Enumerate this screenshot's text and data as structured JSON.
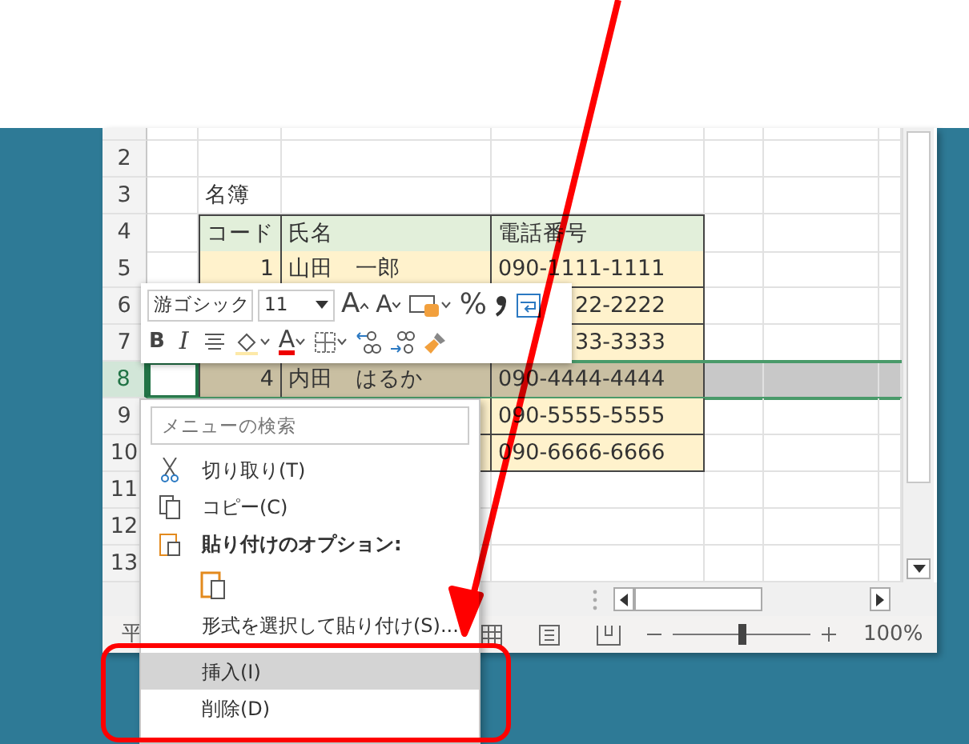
{
  "sheet": {
    "rows": [
      {
        "number": "2",
        "selected": false,
        "cells": [
          {
            "kind": "blank"
          },
          {
            "kind": "blank"
          },
          {
            "kind": "blank"
          },
          {
            "kind": "blank"
          }
        ]
      },
      {
        "number": "3",
        "selected": false,
        "cells": [
          {
            "kind": "blank"
          },
          {
            "text": "名簿",
            "kind": "plain"
          },
          {
            "kind": "blank"
          },
          {
            "kind": "blank"
          }
        ]
      },
      {
        "number": "4",
        "selected": false,
        "cells": [
          {
            "kind": "blank"
          },
          {
            "text": "コード",
            "kind": "head"
          },
          {
            "text": "氏名",
            "kind": "head"
          },
          {
            "text": "電話番号",
            "kind": "head"
          }
        ]
      },
      {
        "number": "5",
        "selected": false,
        "cells": [
          {
            "kind": "blank"
          },
          {
            "text": "1",
            "kind": "number"
          },
          {
            "text": "山田　一郎",
            "kind": "text"
          },
          {
            "text": "090-1111-1111",
            "kind": "text"
          }
        ]
      },
      {
        "number": "6",
        "selected": false,
        "cells": [
          {
            "kind": "blank"
          },
          {
            "kind": "number"
          },
          {
            "kind": "text"
          },
          {
            "text": "22-2222",
            "kind": "tail"
          }
        ]
      },
      {
        "number": "7",
        "selected": false,
        "cells": [
          {
            "kind": "blank"
          },
          {
            "kind": "number"
          },
          {
            "kind": "text"
          },
          {
            "text": "33-3333",
            "kind": "tail"
          }
        ]
      },
      {
        "number": "8",
        "selected": true,
        "cells": [
          {
            "kind": "active"
          },
          {
            "text": "4",
            "kind": "number"
          },
          {
            "text": "内田　はるか",
            "kind": "text"
          },
          {
            "text": "090-4444-4444",
            "kind": "text"
          }
        ]
      },
      {
        "number": "9",
        "selected": false,
        "cells": [
          {
            "kind": "blank"
          },
          {
            "kind": "number"
          },
          {
            "kind": "text"
          },
          {
            "text": "090-5555-5555",
            "kind": "text"
          }
        ]
      },
      {
        "number": "10",
        "selected": false,
        "cells": [
          {
            "kind": "blank"
          },
          {
            "kind": "number"
          },
          {
            "kind": "text"
          },
          {
            "text": "090-6666-6666",
            "kind": "text"
          }
        ]
      },
      {
        "number": "11",
        "selected": false,
        "cells": [
          {
            "kind": "blank"
          },
          {
            "kind": "blank"
          },
          {
            "kind": "blank"
          },
          {
            "kind": "blank"
          }
        ]
      },
      {
        "number": "12",
        "selected": false,
        "cells": [
          {
            "kind": "blank"
          },
          {
            "kind": "blank"
          },
          {
            "kind": "blank"
          },
          {
            "kind": "blank"
          }
        ]
      },
      {
        "number": "13",
        "selected": false,
        "cells": [
          {
            "kind": "blank"
          },
          {
            "kind": "blank"
          },
          {
            "kind": "blank"
          },
          {
            "kind": "blank"
          }
        ]
      }
    ]
  },
  "mini_toolbar": {
    "font": "游ゴシック",
    "size": "11",
    "row_1": [
      {
        "kind": "grow",
        "label": "A"
      },
      {
        "kind": "shrink",
        "label": "A"
      },
      {
        "kind": "number-format"
      },
      {
        "kind": "percent",
        "label": "%"
      },
      {
        "kind": "comma"
      },
      {
        "kind": "wrap"
      }
    ],
    "row_2": [
      {
        "kind": "bold",
        "label": "B"
      },
      {
        "kind": "italic",
        "label": "I"
      },
      {
        "kind": "align"
      },
      {
        "kind": "fill"
      },
      {
        "kind": "font-color",
        "label": "A"
      },
      {
        "kind": "borders"
      },
      {
        "kind": "inc-decimal"
      },
      {
        "kind": "dec-decimal"
      },
      {
        "kind": "painter"
      }
    ]
  },
  "context_menu": {
    "search": {
      "placeholder": "メニューの検索"
    },
    "items": [
      {
        "kind": "cut",
        "label": "切り取り(T)",
        "selected": false
      },
      {
        "kind": "copy",
        "label": "コピー(C)",
        "selected": false
      },
      {
        "kind": "header",
        "label": "貼り付けのオプション:"
      },
      {
        "kind": "paste-options"
      },
      {
        "kind": "item",
        "label": "形式を選択して貼り付け(S)...",
        "selected": false
      },
      {
        "kind": "separator"
      },
      {
        "kind": "item",
        "label": "挿入(I)",
        "selected": true
      },
      {
        "kind": "item",
        "label": "削除(D)",
        "selected": false
      }
    ]
  },
  "status_bar": {
    "text": "平",
    "zoom": {
      "level": 0.5,
      "reading": "100%"
    }
  }
}
